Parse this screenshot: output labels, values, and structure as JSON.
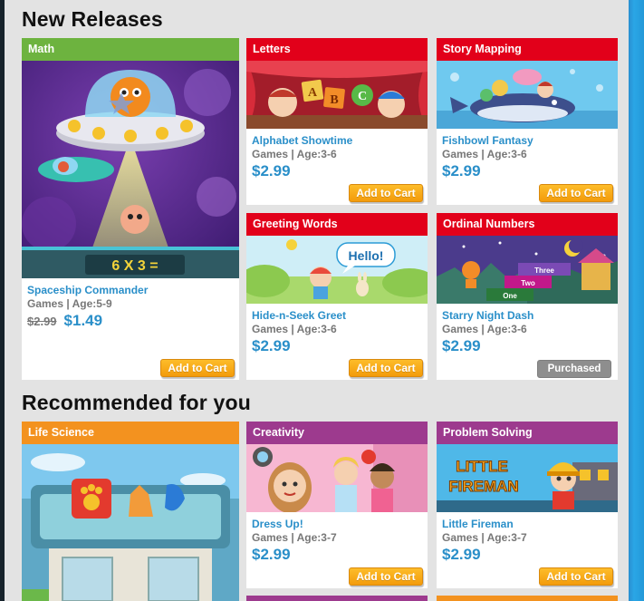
{
  "sections": {
    "new_releases": "New Releases",
    "recommended": "Recommended for you"
  },
  "colors": {
    "math": "#6db33f",
    "red": "#e2001a",
    "orange": "#f3921f",
    "purple": "#9d3a8e",
    "link": "#2a8fc9",
    "cart_button": "#f7a51b",
    "purchased_button": "#8e8e8e"
  },
  "new_releases": [
    {
      "category": "Math",
      "title": "Spaceship Commander",
      "meta": "Games | Age:5-9",
      "old_price": "$2.99",
      "price": "$1.49",
      "button": "Add to Cart",
      "art_text": "6 X 3 ="
    },
    {
      "category": "Letters",
      "title": "Alphabet Showtime",
      "meta": "Games | Age:3-6",
      "price": "$2.99",
      "button": "Add to Cart"
    },
    {
      "category": "Story Mapping",
      "title": "Fishbowl Fantasy",
      "meta": "Games | Age:3-6",
      "price": "$2.99",
      "button": "Add to Cart"
    },
    {
      "category": "Greeting Words",
      "title": "Hide-n-Seek Greet",
      "meta": "Games | Age:3-6",
      "price": "$2.99",
      "button": "Add to Cart",
      "art_text": "Hello!"
    },
    {
      "category": "Ordinal Numbers",
      "title": "Starry Night Dash",
      "meta": "Games | Age:3-6",
      "price": "$2.99",
      "button": "Purchased",
      "art_labels": [
        "Three",
        "Two",
        "One"
      ]
    }
  ],
  "recommended": [
    {
      "category": "Life Science"
    },
    {
      "category": "Creativity",
      "title": "Dress Up!",
      "meta": "Games | Age:3-7",
      "price": "$2.99",
      "button": "Add to Cart"
    },
    {
      "category": "Problem Solving",
      "title": "Little Fireman",
      "meta": "Games | Age:3-7",
      "price": "$2.99",
      "button": "Add to Cart",
      "art_text": [
        "LITTLE",
        "FIREMAN"
      ]
    }
  ]
}
